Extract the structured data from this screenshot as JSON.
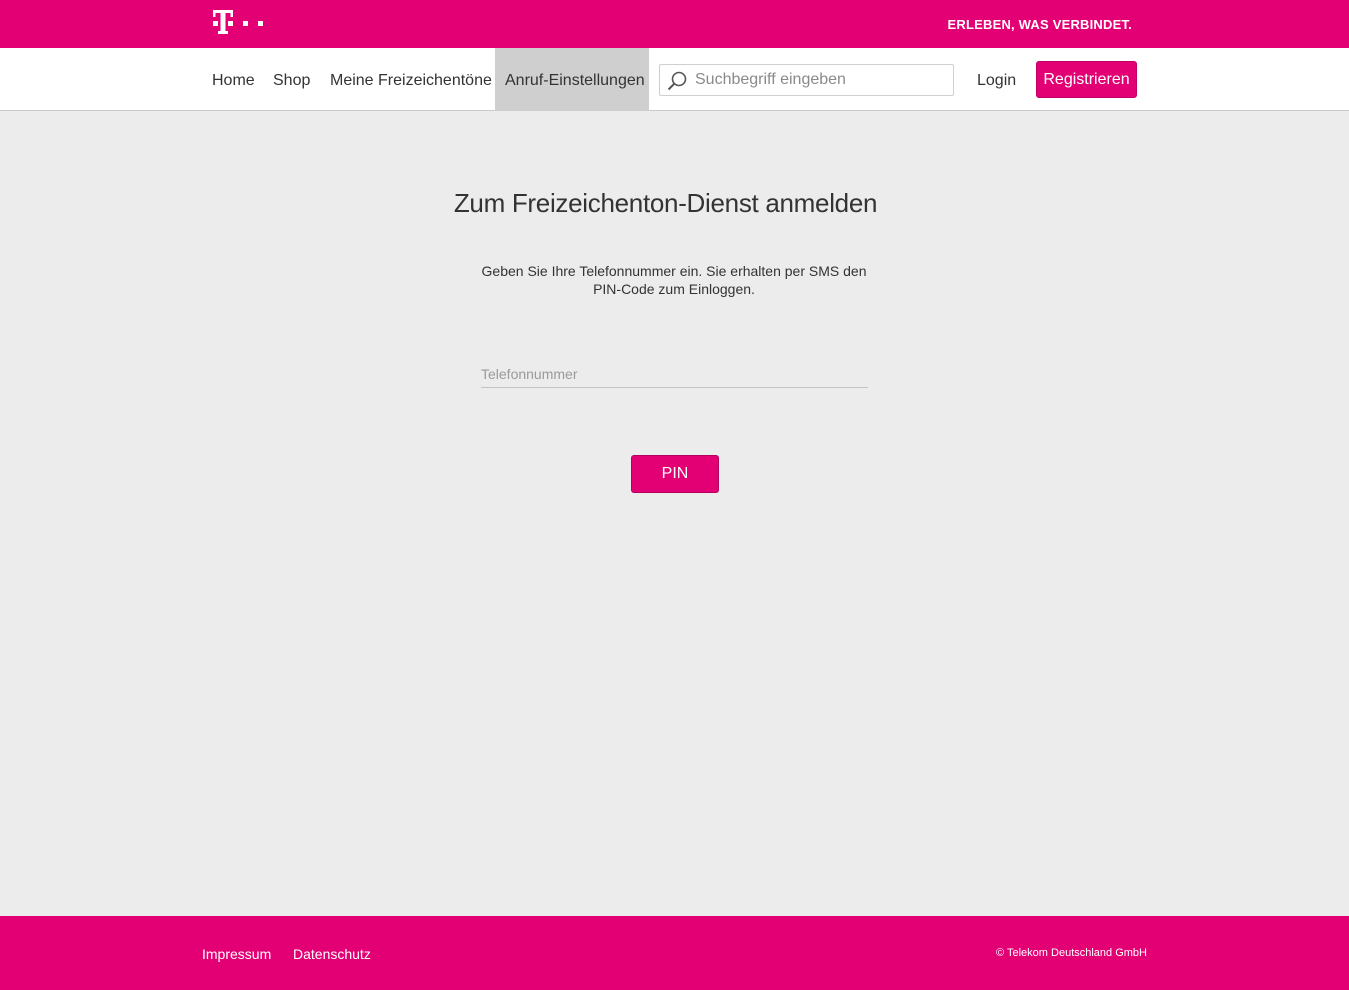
{
  "header": {
    "claim": "ERLEBEN, WAS VERBINDET."
  },
  "nav": {
    "items": [
      {
        "label": "Home"
      },
      {
        "label": "Shop"
      },
      {
        "label": "Meine Freizeichentöne"
      },
      {
        "label": "Anruf-Einstellungen"
      }
    ],
    "active_index": 3,
    "search_placeholder": "Suchbegriff eingeben",
    "login_label": "Login",
    "register_label": "Registrieren"
  },
  "main": {
    "title": "Zum Freizeichenton-Dienst anmelden",
    "description": "Geben Sie Ihre Telefonnummer ein. Sie erhalten per SMS den PIN-Code zum Einloggen.",
    "phone_placeholder": "Telefonnummer",
    "pin_button_label": "PIN"
  },
  "footer": {
    "links": [
      {
        "label": "Impressum"
      },
      {
        "label": "Datenschutz"
      }
    ],
    "copyright": "© Telekom Deutschland GmbH"
  },
  "colors": {
    "brand_magenta": "#e20074",
    "active_nav_bg": "#cfcfcf",
    "page_bg": "#ececec"
  },
  "icons": {
    "logo": "telekom-t-logo",
    "search": "magnifier-icon"
  }
}
